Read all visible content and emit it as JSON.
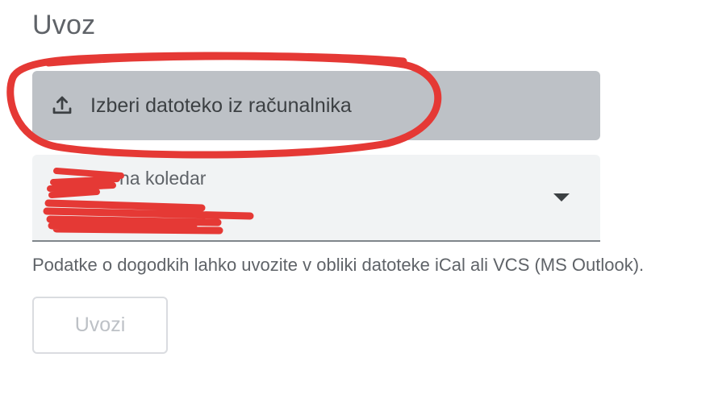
{
  "page": {
    "title": "Uvoz"
  },
  "file_picker": {
    "label": "Izberi datoteko iz računalnika",
    "icon": "upload-icon"
  },
  "calendar_select": {
    "label": "Dodaj na koledar",
    "visible_label_fragment": "na koledar",
    "selected_value": "",
    "icon": "dropdown-arrow-icon"
  },
  "helper": {
    "text": "Podatke o dogodkih lahko uvozite v obliki datoteke iCal ali VCS (MS Outlook)."
  },
  "import_button": {
    "label": "Uvozi",
    "state": "disabled"
  },
  "annotations": {
    "highlight_color": "#e53935",
    "redaction_color": "#e53935"
  }
}
